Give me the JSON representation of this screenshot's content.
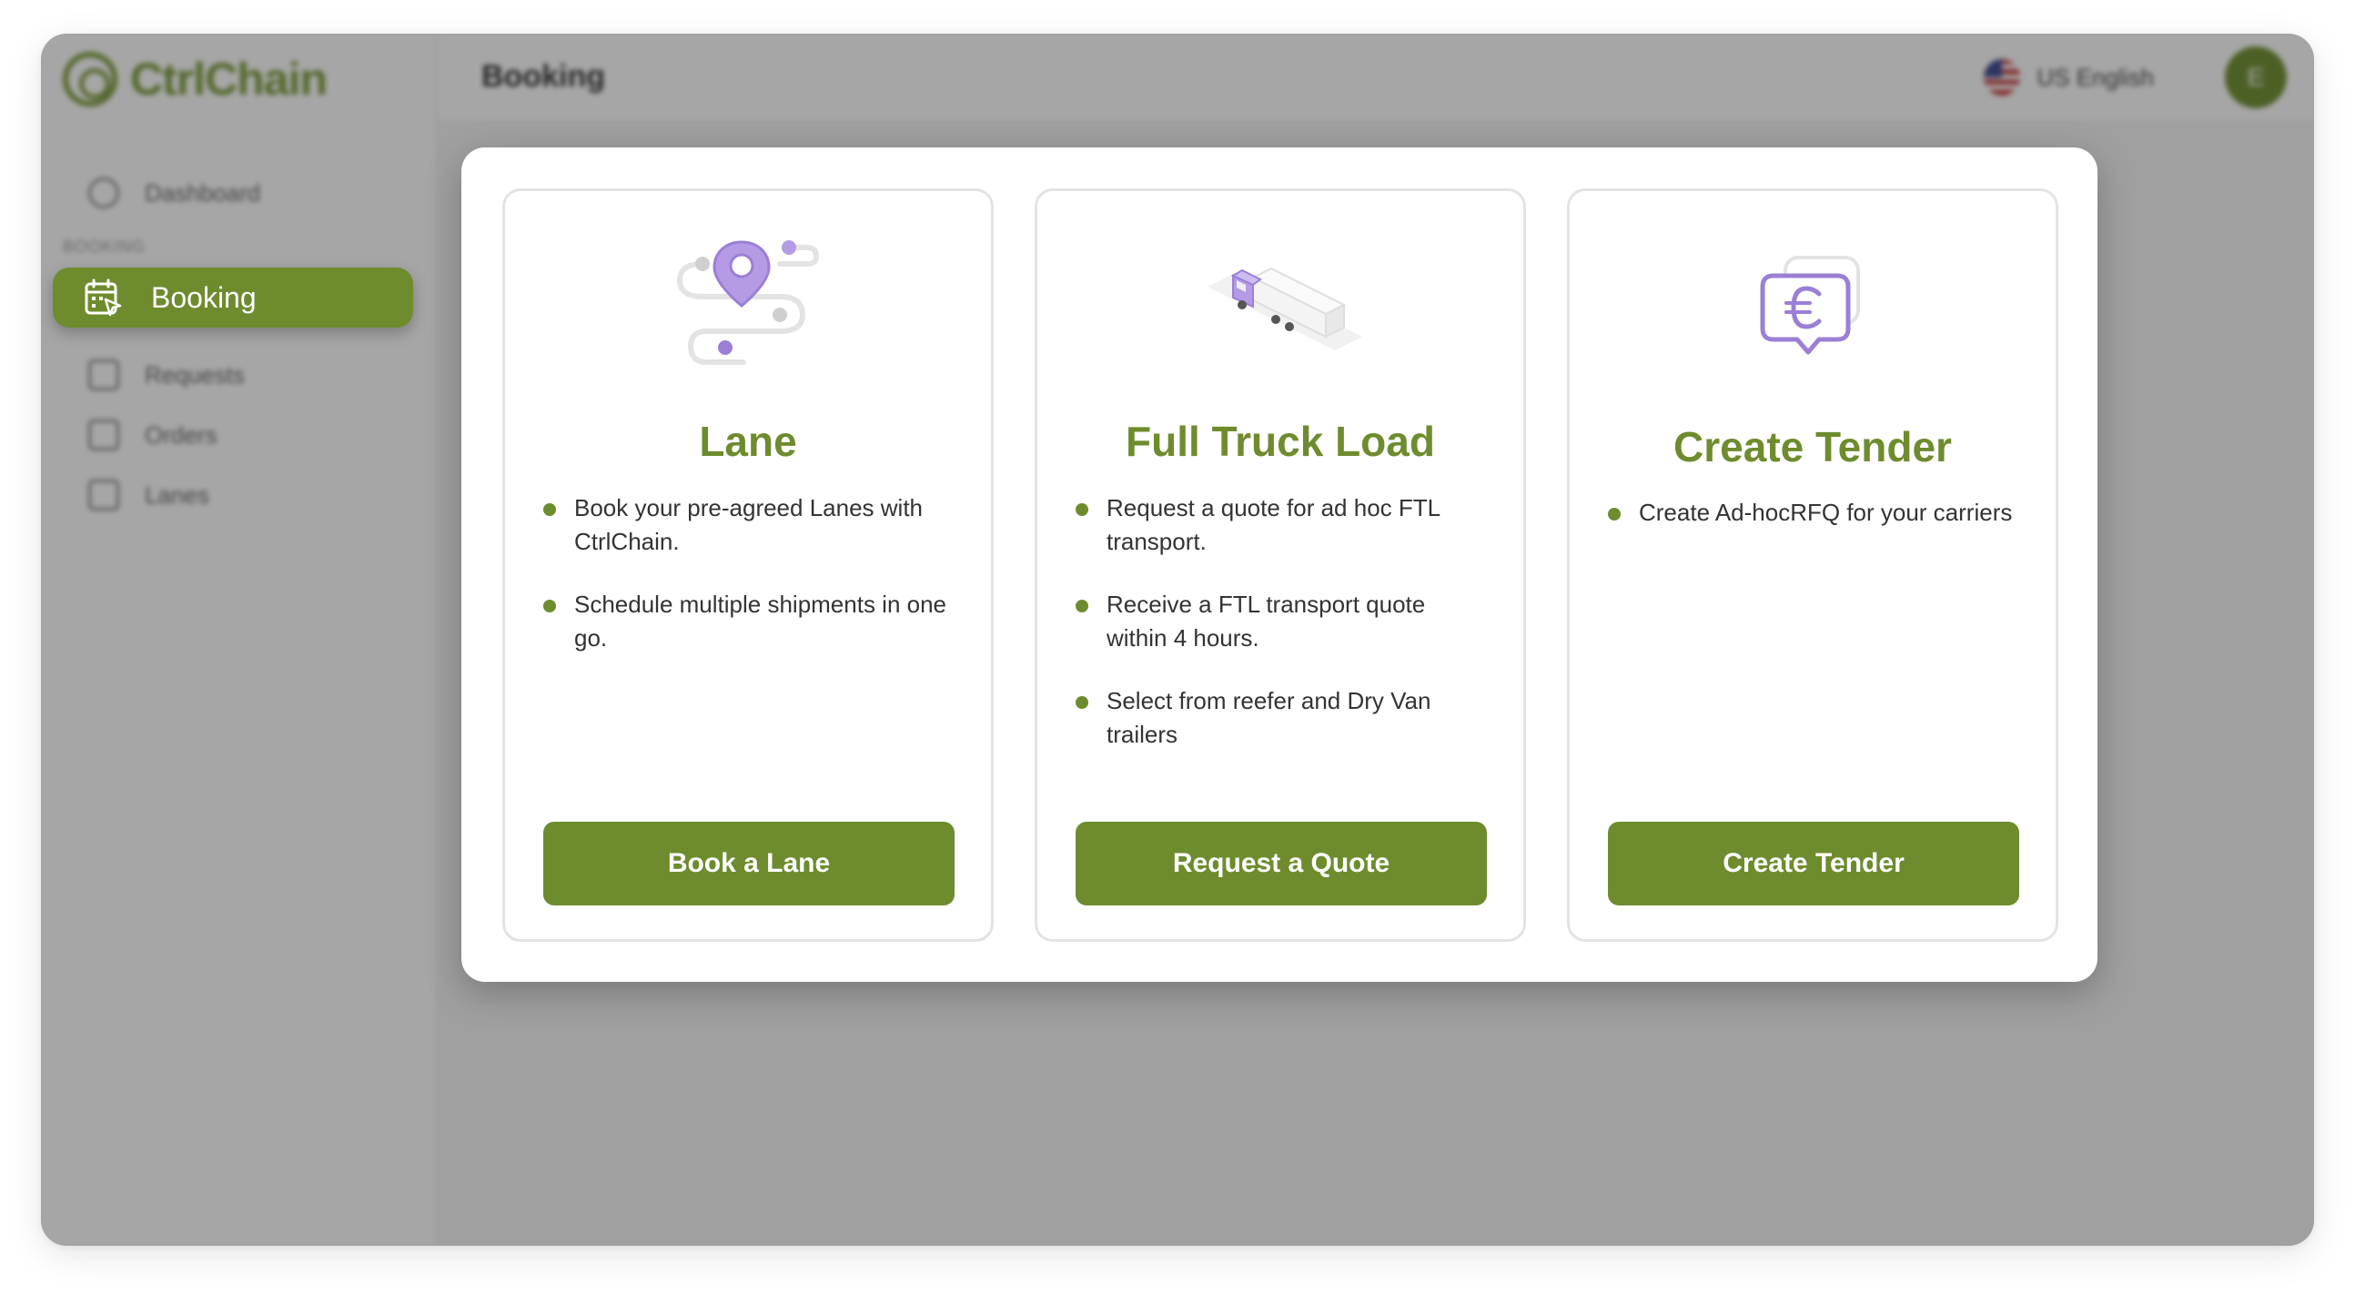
{
  "app": {
    "logo_text": "CtrlChain",
    "page_title": "Booking",
    "language": "US English",
    "avatar_initial": "E"
  },
  "sidebar": {
    "section_label": "BOOKING",
    "items": [
      {
        "label": "Dashboard",
        "icon": "dashboard-icon"
      },
      {
        "label": "Booking",
        "icon": "calendar-cursor-icon",
        "active": true
      },
      {
        "label": "Requests",
        "icon": "requests-icon"
      },
      {
        "label": "Orders",
        "icon": "clipboard-icon"
      },
      {
        "label": "Lanes",
        "icon": "route-icon"
      }
    ]
  },
  "modal": {
    "cards": [
      {
        "title": "Lane",
        "icon": "route-pin-icon",
        "bullets": [
          "Book your pre-agreed Lanes with CtrlChain.",
          "Schedule multiple shipments in one go."
        ],
        "button": "Book a Lane"
      },
      {
        "title": "Full Truck Load",
        "icon": "truck-icon",
        "bullets": [
          "Request a quote for ad hoc FTL transport.",
          "Receive a FTL transport quote within 4 hours.",
          "Select from reefer and Dry Van trailers"
        ],
        "button": "Request a Quote"
      },
      {
        "title": "Create Tender",
        "icon": "euro-chat-icon",
        "bullets": [
          "Create Ad-hocRFQ for your carriers"
        ],
        "button": "Create Tender"
      }
    ]
  },
  "colors": {
    "brand_green": "#6e8c2e",
    "accent_purple": "#9b7fd6",
    "overlay": "rgba(20,20,20,0.38)"
  }
}
